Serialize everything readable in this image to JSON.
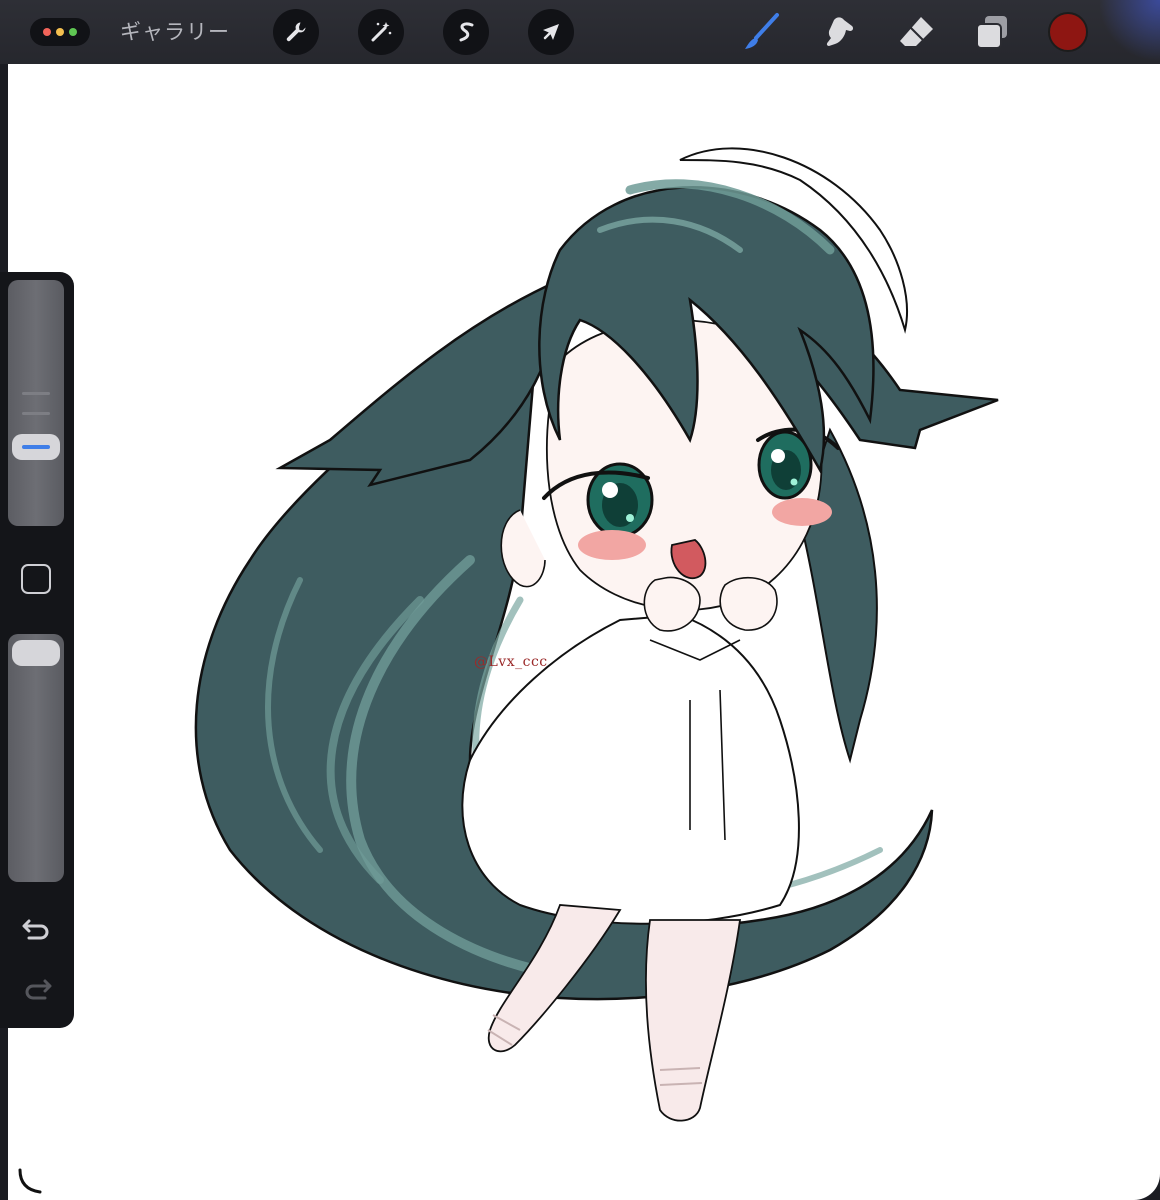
{
  "toolbar": {
    "gallery_label": "ギャラリー",
    "left_tools": [
      "wrench-icon",
      "magic-wand-icon",
      "selection-s-icon",
      "move-arrow-icon"
    ],
    "right_tools": [
      "brush-icon",
      "smudge-icon",
      "eraser-icon",
      "layers-icon"
    ],
    "active_tool": "brush-icon",
    "current_color": "#8e1612"
  },
  "canvas": {
    "watermark": "@Lvx_ccc"
  },
  "sidebar": {
    "brush_size_icon": "brush-size-slider",
    "opacity_icon": "opacity-slider",
    "undo_icon": "undo-icon",
    "redo_icon": "redo-icon",
    "modifier_icon": "square-modifier-icon"
  }
}
